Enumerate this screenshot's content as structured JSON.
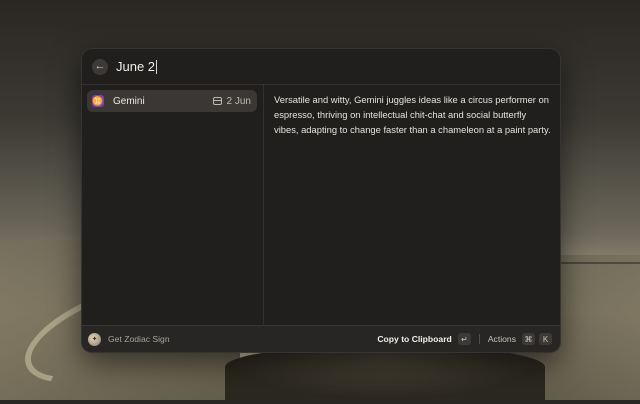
{
  "search": {
    "query": "June 2"
  },
  "list": {
    "items": [
      {
        "icon": "gemini-symbol-icon",
        "glyph": "♊",
        "title": "Gemini",
        "date": "2 Jun",
        "selected": true
      }
    ]
  },
  "detail": {
    "text": "Versatile and witty, Gemini juggles ideas like a circus performer on espresso, thriving on intellectual chit-chat and social butterfly vibes, adapting to change faster than a chameleon at a paint party."
  },
  "action_bar": {
    "extension_name": "Get Zodiac Sign",
    "primary_action": "Copy to Clipboard",
    "primary_shortcut": "↵",
    "actions_label": "Actions",
    "actions_shortcut": [
      "⌘",
      "K"
    ]
  },
  "colors": {
    "window_bg": "#211f1d",
    "selected_row": "#3a3734",
    "gemini_icon": "#7b3fc6"
  }
}
